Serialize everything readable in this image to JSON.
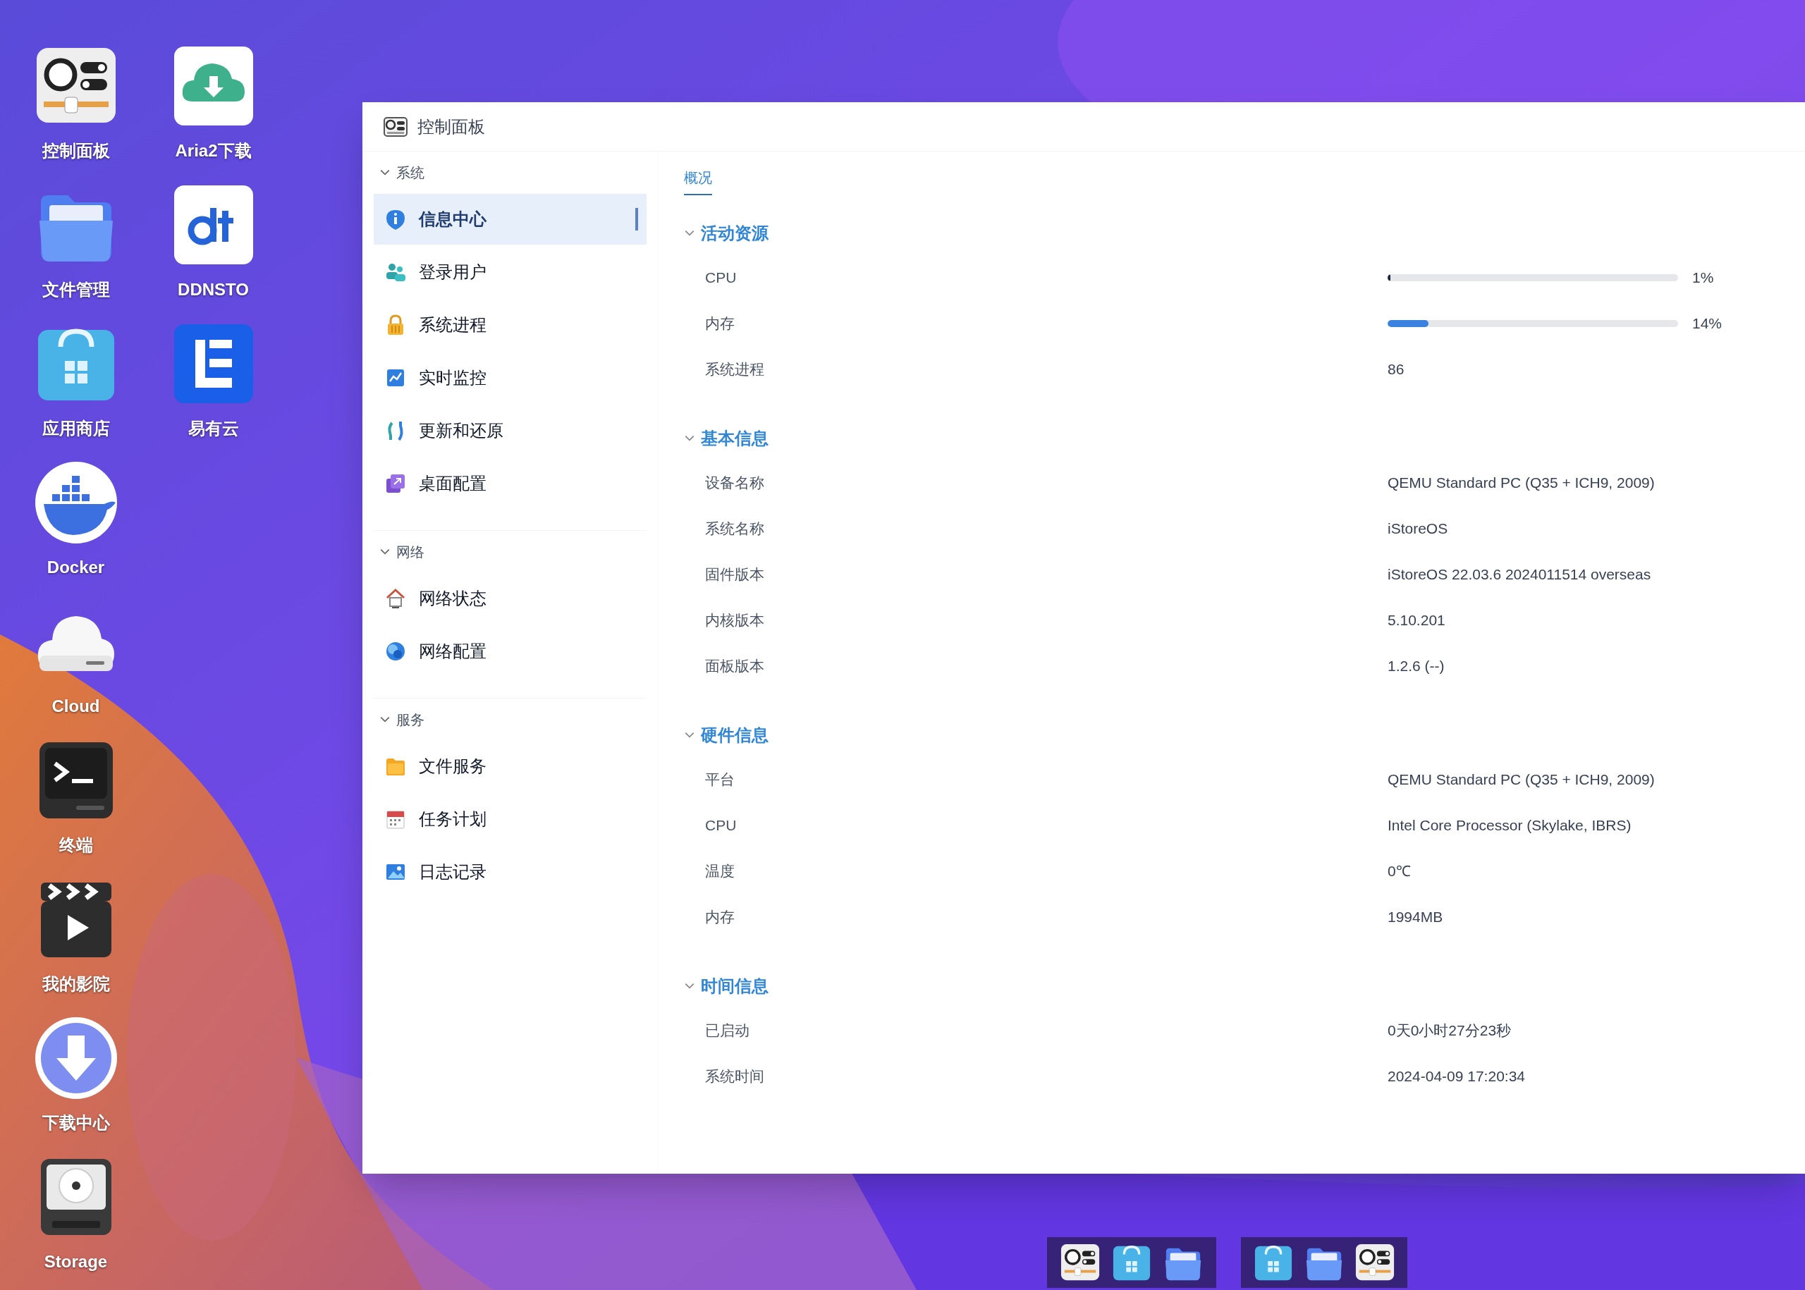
{
  "desktop_icons": [
    {
      "label": "控制面板"
    },
    {
      "label": "文件管理"
    },
    {
      "label": "应用商店"
    },
    {
      "label": "Docker"
    },
    {
      "label": "Cloud"
    },
    {
      "label": "终端"
    },
    {
      "label": "我的影院"
    },
    {
      "label": "下载中心"
    },
    {
      "label": "Storage"
    },
    {
      "label": "Aria2下载"
    },
    {
      "label": "DDNSTO"
    },
    {
      "label": "易有云"
    }
  ],
  "window": {
    "title": "控制面板"
  },
  "sidebar": {
    "groups": [
      {
        "label": "系统",
        "expanded": true,
        "items": [
          {
            "label": "信息中心",
            "selected": true
          },
          {
            "label": "登录用户",
            "selected": false
          },
          {
            "label": "系统进程",
            "selected": false
          },
          {
            "label": "实时监控",
            "selected": false
          },
          {
            "label": "更新和还原",
            "selected": false
          },
          {
            "label": "桌面配置",
            "selected": false
          }
        ]
      },
      {
        "label": "网络",
        "expanded": true,
        "items": [
          {
            "label": "网络状态",
            "selected": false
          },
          {
            "label": "网络配置",
            "selected": false
          }
        ]
      },
      {
        "label": "服务",
        "expanded": true,
        "items": [
          {
            "label": "文件服务",
            "selected": false
          },
          {
            "label": "任务计划",
            "selected": false
          },
          {
            "label": "日志记录",
            "selected": false
          }
        ]
      }
    ]
  },
  "tabs": [
    {
      "label": "概况",
      "selected": true
    }
  ],
  "sections": [
    {
      "title": "活动资源",
      "expanded": true,
      "rows": [
        {
          "kind": "meter",
          "label": "CPU",
          "level": 0.01,
          "reading": "1%"
        },
        {
          "kind": "meter",
          "label": "内存",
          "level": 0.14,
          "reading": "14%"
        },
        {
          "kind": "text",
          "label": "系统进程",
          "value": "86"
        }
      ]
    },
    {
      "title": "基本信息",
      "expanded": true,
      "rows": [
        {
          "kind": "text",
          "label": "设备名称",
          "value": "QEMU Standard PC (Q35 + ICH9, 2009)"
        },
        {
          "kind": "text",
          "label": "系统名称",
          "value": "iStoreOS"
        },
        {
          "kind": "text",
          "label": "固件版本",
          "value": "iStoreOS 22.03.6 2024011514 overseas"
        },
        {
          "kind": "text",
          "label": "内核版本",
          "value": "5.10.201"
        },
        {
          "kind": "text",
          "label": "面板版本",
          "value": "1.2.6 (--)"
        }
      ]
    },
    {
      "title": "硬件信息",
      "expanded": true,
      "rows": [
        {
          "kind": "text",
          "label": "平台",
          "value": "QEMU Standard PC (Q35 + ICH9, 2009)"
        },
        {
          "kind": "text",
          "label": "CPU",
          "value": "Intel Core Processor (Skylake, IBRS)"
        },
        {
          "kind": "text",
          "label": "温度",
          "value": "0℃"
        },
        {
          "kind": "text",
          "label": "内存",
          "value": "1994MB"
        }
      ]
    },
    {
      "title": "时间信息",
      "expanded": true,
      "rows": [
        {
          "kind": "text",
          "label": "已启动",
          "value": "0天0小时27分23秒"
        },
        {
          "kind": "text",
          "label": "系统时间",
          "value": "2024-04-09 17:20:34"
        }
      ]
    }
  ]
}
